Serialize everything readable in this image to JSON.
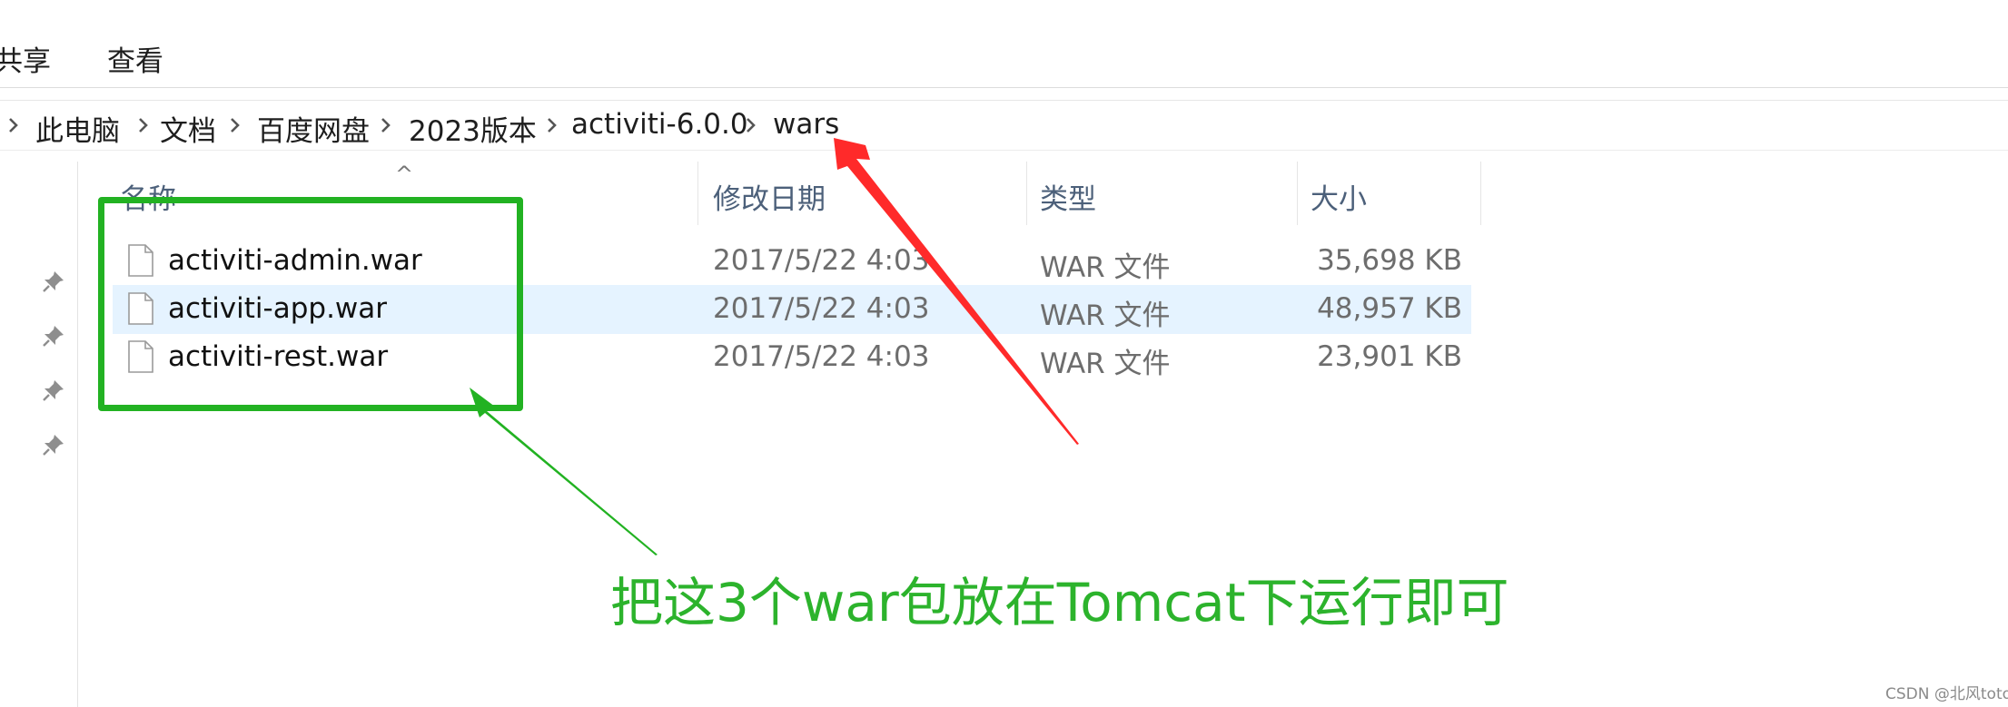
{
  "ribbon": {
    "tabs": [
      {
        "label": "共享"
      },
      {
        "label": "查看"
      }
    ]
  },
  "breadcrumb": {
    "items": [
      {
        "label": "此电脑"
      },
      {
        "label": "文档"
      },
      {
        "label": "百度网盘"
      },
      {
        "label": "2023版本"
      },
      {
        "label": "activiti-6.0.0"
      },
      {
        "label": "wars"
      }
    ]
  },
  "file_list": {
    "columns": [
      {
        "label": "名称"
      },
      {
        "label": "修改日期"
      },
      {
        "label": "类型"
      },
      {
        "label": "大小"
      }
    ],
    "sort_indicator": "^",
    "rows": [
      {
        "name": "activiti-admin.war",
        "modified": "2017/5/22 4:03",
        "type": "WAR 文件",
        "size": "35,698 KB",
        "selected": false
      },
      {
        "name": "activiti-app.war",
        "modified": "2017/5/22 4:03",
        "type": "WAR 文件",
        "size": "48,957 KB",
        "selected": true
      },
      {
        "name": "activiti-rest.war",
        "modified": "2017/5/22 4:03",
        "type": "WAR 文件",
        "size": "23,901 KB",
        "selected": false
      }
    ]
  },
  "annotation": {
    "caption": "把这3个war包放在Tomcat下运行即可",
    "box_color": "#22b222",
    "arrow_red": "#ff2a2a",
    "arrow_green": "#22b222"
  },
  "watermark": "CSDN @北风toto",
  "icons": {
    "breadcrumb_separator": "chevron-right-icon",
    "pin": "pin-icon",
    "file": "file-icon"
  }
}
